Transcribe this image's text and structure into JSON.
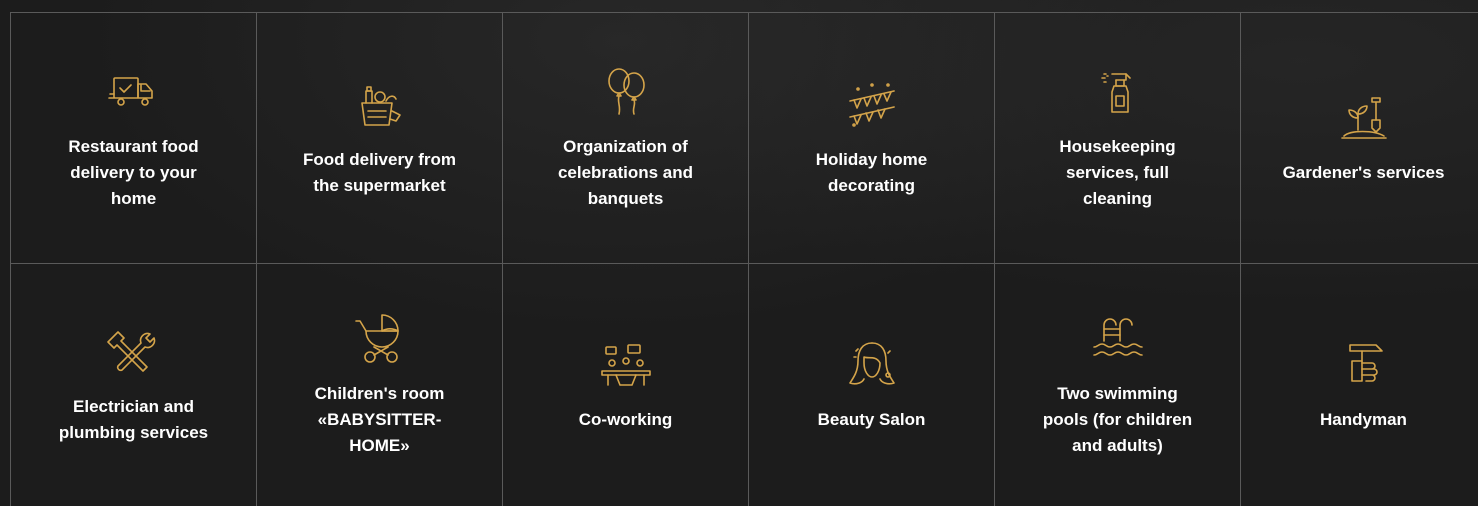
{
  "accent_color": "#d4a44a",
  "services": [
    {
      "label": "Restaurant food delivery to your home",
      "icon": "delivery-truck-icon"
    },
    {
      "label": "Food delivery from the supermarket",
      "icon": "grocery-bag-icon"
    },
    {
      "label": "Organization of celebrations and banquets",
      "icon": "balloons-icon"
    },
    {
      "label": "Holiday home decorating",
      "icon": "garland-icon"
    },
    {
      "label": "Housekeeping services, full cleaning",
      "icon": "spray-bottle-icon"
    },
    {
      "label": "Gardener's services",
      "icon": "shovel-plant-icon"
    },
    {
      "label": "Electrician and plumbing services",
      "icon": "wrench-tools-icon"
    },
    {
      "label": "Children's room «BABYSITTER-HOME»",
      "icon": "baby-stroller-icon"
    },
    {
      "label": "Co-working",
      "icon": "meeting-table-icon"
    },
    {
      "label": "Beauty Salon",
      "icon": "woman-face-icon"
    },
    {
      "label": "Two swimming pools (for children and adults)",
      "icon": "pool-ladder-icon"
    },
    {
      "label": "Handyman",
      "icon": "hammer-hand-icon"
    }
  ]
}
